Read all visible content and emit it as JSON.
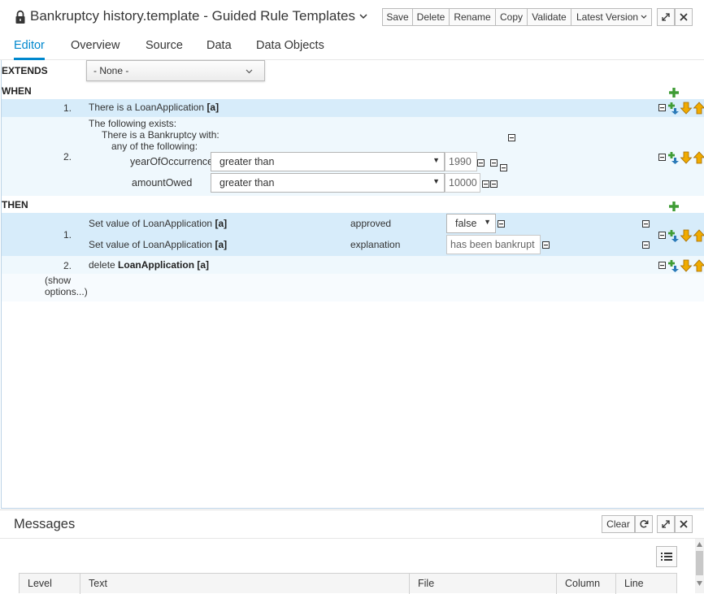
{
  "header": {
    "title": "Bankruptcy history.template - Guided Rule Templates",
    "buttons": {
      "save": "Save",
      "delete": "Delete",
      "rename": "Rename",
      "copy": "Copy",
      "validate": "Validate",
      "latest_version": "Latest Version"
    },
    "icons": [
      "lock-icon",
      "chevron-down-icon",
      "maximize-icon",
      "close-icon"
    ]
  },
  "tabs": [
    {
      "label": "Editor",
      "active": true
    },
    {
      "label": "Overview",
      "active": false
    },
    {
      "label": "Source",
      "active": false
    },
    {
      "label": "Data",
      "active": false
    },
    {
      "label": "Data Objects",
      "active": false
    }
  ],
  "editor": {
    "extends_label": "EXTENDS",
    "extends_value": "- None -",
    "when_label": "WHEN",
    "then_label": "THEN",
    "when_rows": [
      {
        "num": "1.",
        "prefix": "There is a LoanApplication",
        "binding": "[a]"
      },
      {
        "num": "2.",
        "line1": "The following exists:",
        "line2": "There is a Bankruptcy with:",
        "line3": "any of the following:",
        "constraints": [
          {
            "field": "yearOfOccurrence",
            "operator": "greater than",
            "value": "1990"
          },
          {
            "field": "amountOwed",
            "operator": "greater than",
            "value": "10000"
          }
        ]
      }
    ],
    "then_rows": [
      {
        "num": "1.",
        "actions": [
          {
            "prefix": "Set value of LoanApplication",
            "binding": "[a]",
            "field": "approved",
            "value": "false"
          },
          {
            "prefix": "Set value of LoanApplication",
            "binding": "[a]",
            "field": "explanation",
            "value": "has been bankrupt"
          }
        ]
      },
      {
        "num": "2.",
        "prefix": "delete",
        "target": "LoanApplication",
        "binding": "[a]"
      }
    ],
    "show_options_line1": "(show",
    "show_options_line2": "options...)"
  },
  "messages": {
    "title": "Messages",
    "clear": "Clear",
    "columns": [
      "Level",
      "Text",
      "File",
      "Column",
      "Line"
    ]
  },
  "colors": {
    "accent": "#0088ce",
    "row_band_dark": "#d7ecfa",
    "row_band_light": "#eff8fd",
    "add_green": "#3f9c35",
    "arrow_orange": "#f0ab00",
    "arrow_blue": "#2a7ab8"
  }
}
